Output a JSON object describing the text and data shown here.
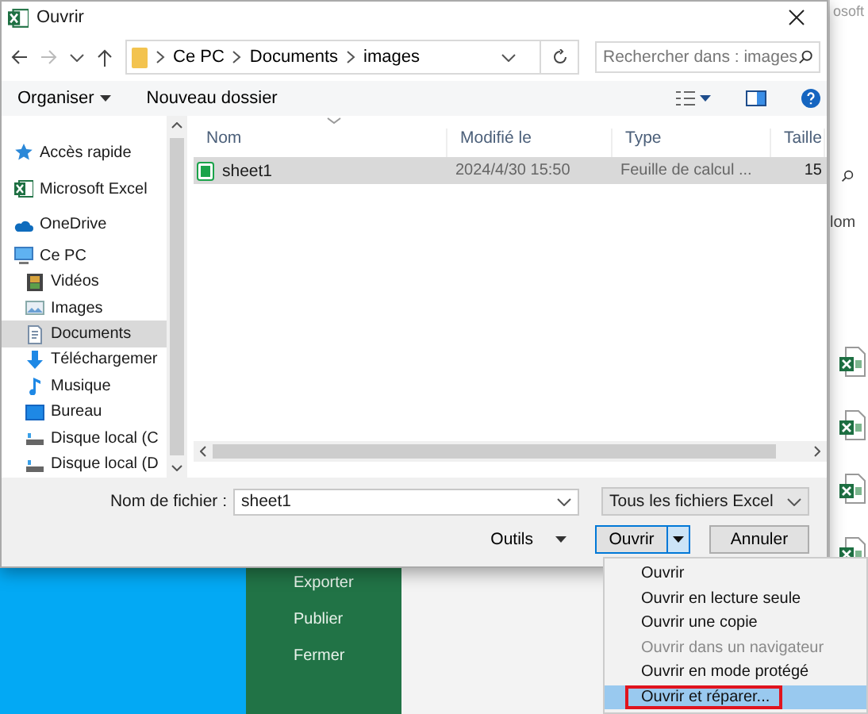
{
  "window": {
    "title": "Ouvrir"
  },
  "address": {
    "path": [
      "Ce PC",
      "Documents",
      "images"
    ]
  },
  "search": {
    "placeholder": "Rechercher dans : images"
  },
  "toolbar": {
    "organize": "Organiser",
    "new_folder": "Nouveau dossier"
  },
  "sidebar": {
    "items": [
      {
        "label": "Accès rapide",
        "kind": "star",
        "selected": false
      },
      {
        "label": "Microsoft Excel",
        "kind": "excel",
        "selected": false
      },
      {
        "label": "OneDrive",
        "kind": "cloud",
        "selected": false
      },
      {
        "label": "Ce PC",
        "kind": "pc",
        "selected": false,
        "children": [
          {
            "label": "Vidéos",
            "kind": "video",
            "selected": false
          },
          {
            "label": "Images",
            "kind": "image",
            "selected": false
          },
          {
            "label": "Documents",
            "kind": "document",
            "selected": true
          },
          {
            "label": "Téléchargemer",
            "kind": "download",
            "selected": false
          },
          {
            "label": "Musique",
            "kind": "music",
            "selected": false
          },
          {
            "label": "Bureau",
            "kind": "desktop",
            "selected": false
          },
          {
            "label": "Disque local (C",
            "kind": "drive",
            "selected": false
          },
          {
            "label": "Disque local (D",
            "kind": "drive",
            "selected": false
          }
        ]
      }
    ]
  },
  "file_list": {
    "columns": [
      "Nom",
      "Modifié le",
      "Type",
      "Taille"
    ],
    "rows": [
      {
        "cells": [
          "sheet1",
          "2024/4/30 15:50",
          "Feuille de calcul ...",
          "15"
        ],
        "selected": true
      }
    ]
  },
  "footer": {
    "filename_label": "Nom de fichier :",
    "filename": "sheet1",
    "filter": "Tous les fichiers Excel",
    "tools": "Outils",
    "open": "Ouvrir",
    "cancel": "Annuler"
  },
  "open_menu": {
    "items": [
      {
        "label": "Ouvrir",
        "disabled": false,
        "selected": false,
        "annotated": false
      },
      {
        "label": "Ouvrir en lecture seule",
        "disabled": false,
        "selected": false,
        "annotated": false
      },
      {
        "label": "Ouvrir une copie",
        "disabled": false,
        "selected": false,
        "annotated": false
      },
      {
        "label": "Ouvrir dans un navigateur",
        "disabled": true,
        "selected": false,
        "annotated": false
      },
      {
        "label": "Ouvrir en mode protégé",
        "disabled": false,
        "selected": false,
        "annotated": false
      },
      {
        "label": "Ouvrir et réparer...",
        "disabled": false,
        "selected": true,
        "annotated": true
      }
    ]
  },
  "background": {
    "top_text": "osoft",
    "column_header": "lom",
    "backstage": [
      "Exporter",
      "Publier",
      "Fermer"
    ]
  }
}
